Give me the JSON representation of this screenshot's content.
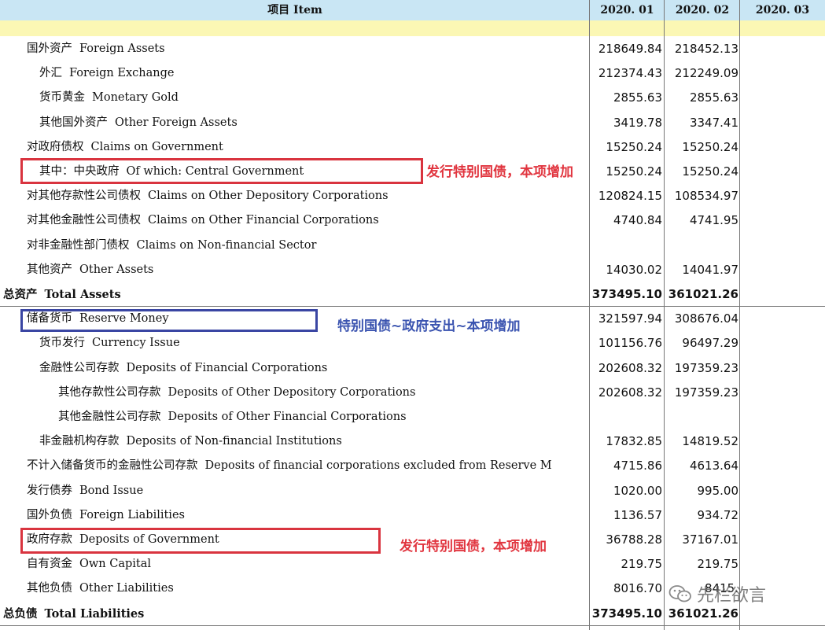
{
  "header": {
    "item": "项目 Item",
    "col1": "2020. 01",
    "col2": "2020. 02",
    "col3": "2020. 03"
  },
  "rows": [
    {
      "zh": "国外资产",
      "en": "Foreign Assets",
      "v1": "218649.84",
      "v2": "218452.13"
    },
    {
      "zh": "外汇",
      "en": "Foreign Exchange",
      "v1": "212374.43",
      "v2": "212249.09"
    },
    {
      "zh": "货币黄金",
      "en": "Monetary Gold",
      "v1": "2855.63",
      "v2": "2855.63"
    },
    {
      "zh": "其他国外资产",
      "en": "Other Foreign Assets",
      "v1": "3419.78",
      "v2": "3347.41"
    },
    {
      "zh": "对政府债权",
      "en": "Claims on Government",
      "v1": "15250.24",
      "v2": "15250.24"
    },
    {
      "zh": "其中：中央政府",
      "en": "Of which: Central Government",
      "v1": "15250.24",
      "v2": "15250.24"
    },
    {
      "zh": "对其他存款性公司债权",
      "en": "Claims on Other Depository Corporations",
      "v1": "120824.15",
      "v2": "108534.97"
    },
    {
      "zh": "对其他金融性公司债权",
      "en": "Claims on Other Financial Corporations",
      "v1": "4740.84",
      "v2": "4741.95"
    },
    {
      "zh": "对非金融性部门债权",
      "en": "Claims on Non-financial Sector",
      "v1": "",
      "v2": ""
    },
    {
      "zh": "其他资产",
      "en": "Other Assets",
      "v1": "14030.02",
      "v2": "14041.97"
    },
    {
      "zh": "总资产",
      "en": "Total Assets",
      "v1": "373495.10",
      "v2": "361021.26"
    },
    {
      "zh": "储备货币",
      "en": "Reserve Money",
      "v1": "321597.94",
      "v2": "308676.04"
    },
    {
      "zh": "货币发行",
      "en": "Currency Issue",
      "v1": "101156.76",
      "v2": "96497.29"
    },
    {
      "zh": "金融性公司存款",
      "en": "Deposits of  Financial Corporations",
      "v1": "202608.32",
      "v2": "197359.23"
    },
    {
      "zh": "其他存款性公司存款",
      "en": "Deposits of  Other Depository Corporations",
      "v1": "202608.32",
      "v2": "197359.23"
    },
    {
      "zh": "其他金融性公司存款",
      "en": "Deposits of  Other Financial Corporations",
      "v1": "",
      "v2": ""
    },
    {
      "zh": "非金融机构存款",
      "en": "Deposits of  Non-financial Institutions",
      "v1": "17832.85",
      "v2": "14819.52"
    },
    {
      "zh": "不计入储备货币的金融性公司存款",
      "en": "Deposits of financial corporations excluded from Reserve M",
      "v1": "4715.86",
      "v2": "4613.64"
    },
    {
      "zh": "发行债券",
      "en": "Bond Issue",
      "v1": "1020.00",
      "v2": "995.00"
    },
    {
      "zh": "国外负债",
      "en": "Foreign Liabilities",
      "v1": "1136.57",
      "v2": "934.72"
    },
    {
      "zh": "政府存款",
      "en": "Deposits of Government",
      "v1": "36788.28",
      "v2": "37167.01"
    },
    {
      "zh": "自有资金",
      "en": "Own Capital",
      "v1": "219.75",
      "v2": "219.75"
    },
    {
      "zh": "其他负债",
      "en": "Other Liabilities",
      "v1": "8016.70",
      "v2": "8415."
    },
    {
      "zh": "总负债",
      "en": "Total  Liabilities",
      "v1": "373495.10",
      "v2": "361021.26"
    }
  ],
  "annotations": {
    "central_gov_note": "发行特别国债，本项增加",
    "reserve_money_note": "特别国债~政府支出~本项增加",
    "gov_deposits_note": "发行特别国债，本项增加"
  },
  "watermark": {
    "icon": "wechat-icon",
    "text": "先栏欲言"
  },
  "colors": {
    "header_bg": "#c9e6f4",
    "yellow_band": "#fbf7b4",
    "red": "#d9343f",
    "blue": "#3a46a3"
  }
}
